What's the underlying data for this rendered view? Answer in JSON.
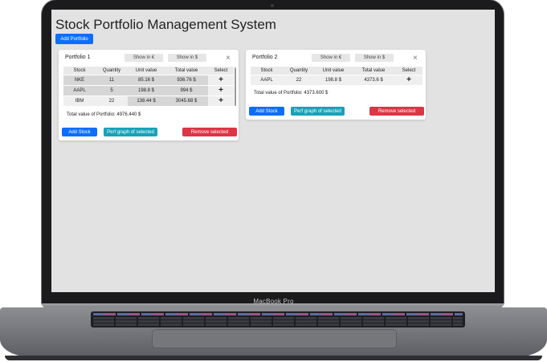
{
  "device_label": "MacBook Pro",
  "app": {
    "title": "Stock Portfolio Management System",
    "add_portfolio_label": "Add Portfolio"
  },
  "portfolios": [
    {
      "title": "Portfolio 1",
      "show_eur_label": "Show in €",
      "show_usd_label": "Show in $",
      "close_symbol": "×",
      "columns": [
        "Stock",
        "Quantity",
        "Unit value",
        "Total value",
        "Select"
      ],
      "rows": [
        {
          "stock": "NKE",
          "quantity": "11",
          "unit_value": "85.16 $",
          "total_value": "936.76 $",
          "select": "+"
        },
        {
          "stock": "AAPL",
          "quantity": "5",
          "unit_value": "198.8 $",
          "total_value": "994 $",
          "select": "+"
        },
        {
          "stock": "IBM",
          "quantity": "22",
          "unit_value": "138.44 $",
          "total_value": "3045.68 $",
          "select": "+"
        }
      ],
      "total_text": "Total value of Portfolio: 4976.440 $",
      "add_stock_label": "Add Stock",
      "perf_graph_label": "Perf graph of selected",
      "remove_selected_label": "Remove selected"
    },
    {
      "title": "Portfolio 2",
      "show_eur_label": "Show in €",
      "show_usd_label": "Show in $",
      "close_symbol": "×",
      "columns": [
        "Stock",
        "Quantity",
        "Unit value",
        "Total value",
        "Select"
      ],
      "rows": [
        {
          "stock": "AAPL",
          "quantity": "22",
          "unit_value": "198.8 $",
          "total_value": "4373.6 $",
          "select": "+"
        }
      ],
      "total_text": "Total value of Portfolio: 4373.600 $",
      "add_stock_label": "Add Stock",
      "perf_graph_label": "Perf graph of selected",
      "remove_selected_label": "Remove selected"
    }
  ],
  "colors": {
    "primary": "#0d6efd",
    "info": "#17a2b8",
    "danger": "#dc3545",
    "screen_bg": "#e2e2e2"
  }
}
